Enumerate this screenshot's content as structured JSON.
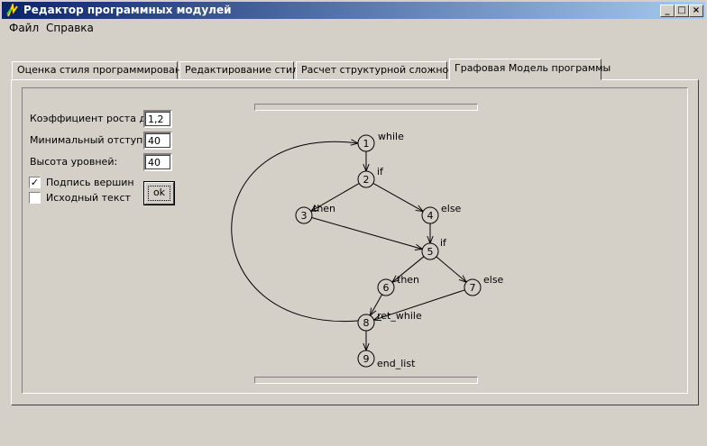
{
  "window": {
    "title": "Редактор программных модулей",
    "buttons": {
      "minimize": "_",
      "maximize": "□",
      "close": "×"
    }
  },
  "menu": {
    "file": "Файл",
    "help": "Справка"
  },
  "tabs": [
    {
      "label": "Оценка стиля программирования"
    },
    {
      "label": "Редактирование стиля"
    },
    {
      "label": "Расчет структурной сложности"
    },
    {
      "label": "Графовая Модель программы"
    }
  ],
  "settings": {
    "arc_growth_label": "Коэффициент роста дуг:",
    "arc_growth_value": "1,2",
    "min_indent_label": "Минимальный отступ:",
    "min_indent_value": "40",
    "level_height_label": "Высота уровней:",
    "level_height_value": "40",
    "vertex_labels_label": "Подпись вершин",
    "vertex_labels_checked": true,
    "source_text_label": "Исходный текст",
    "source_text_checked": false,
    "ok_label": "ok"
  },
  "graph": {
    "nodes": [
      {
        "id": "1",
        "label": "while"
      },
      {
        "id": "2",
        "label": "if"
      },
      {
        "id": "3",
        "label": "then"
      },
      {
        "id": "4",
        "label": "else"
      },
      {
        "id": "5",
        "label": "if"
      },
      {
        "id": "6",
        "label": "then"
      },
      {
        "id": "7",
        "label": "else"
      },
      {
        "id": "8",
        "label": "ret_while"
      },
      {
        "id": "9",
        "label": "end_list"
      }
    ],
    "edges": [
      [
        "1",
        "2"
      ],
      [
        "2",
        "3"
      ],
      [
        "2",
        "4"
      ],
      [
        "3",
        "5"
      ],
      [
        "4",
        "5"
      ],
      [
        "5",
        "6"
      ],
      [
        "5",
        "7"
      ],
      [
        "6",
        "8"
      ],
      [
        "7",
        "8"
      ],
      [
        "8",
        "9"
      ],
      [
        "8",
        "1"
      ]
    ]
  }
}
